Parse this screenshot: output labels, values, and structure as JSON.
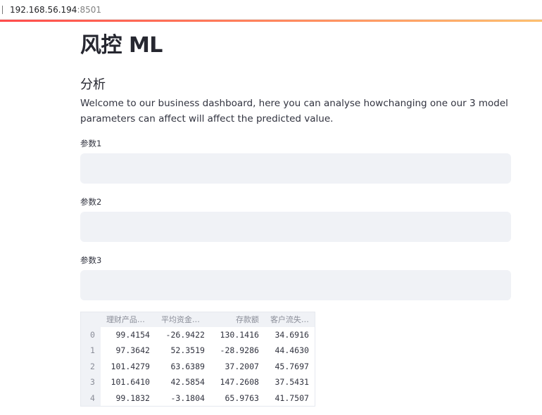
{
  "browser": {
    "host": "192.168.56.194",
    "port": ":8501"
  },
  "colors": {
    "accent_start": "#ff4b4b",
    "accent_end": "#fdbf6f",
    "input_bg": "#f0f2f6"
  },
  "title": "风控 ML",
  "subheader": "分析",
  "intro": "Welcome to our business dashboard, here you can analyse howchanging one our 3 model parameters can affect will affect the predicted value.",
  "inputs": [
    {
      "label": "参数1",
      "value": ""
    },
    {
      "label": "参数2",
      "value": ""
    },
    {
      "label": "参数3",
      "value": ""
    }
  ],
  "table": {
    "columns": [
      "理财产品…",
      "平均资金…",
      "存款额",
      "客户流失…"
    ],
    "rows": [
      {
        "index": "0",
        "cells": [
          "99.4154",
          "-26.9422",
          "130.1416",
          "34.6916"
        ]
      },
      {
        "index": "1",
        "cells": [
          "97.3642",
          "52.3519",
          "-28.9286",
          "44.4630"
        ]
      },
      {
        "index": "2",
        "cells": [
          "101.4279",
          "63.6389",
          "37.2007",
          "45.7697"
        ]
      },
      {
        "index": "3",
        "cells": [
          "101.6410",
          "42.5854",
          "147.2608",
          "37.5431"
        ]
      },
      {
        "index": "4",
        "cells": [
          "99.1832",
          "-3.1804",
          "65.9763",
          "41.7507"
        ]
      }
    ]
  }
}
